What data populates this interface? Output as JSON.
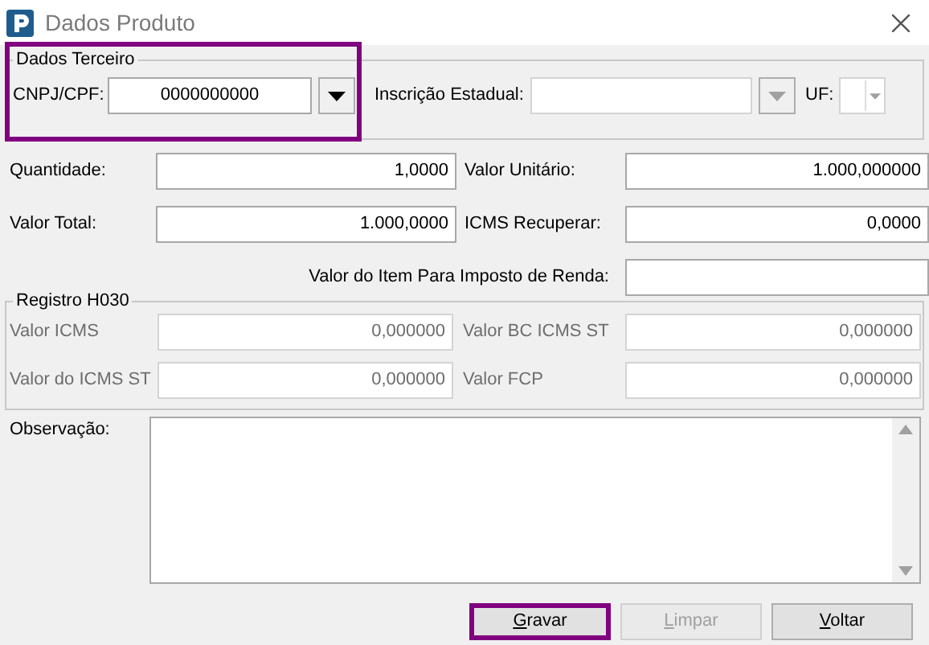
{
  "window": {
    "title": "Dados Produto"
  },
  "dados_terceiro": {
    "legend": "Dados Terceiro",
    "highlighted": true,
    "cnpj_cpf": {
      "label": "CNPJ/CPF:",
      "value": "0000000000",
      "disabled": false
    },
    "inscricao_estadual": {
      "label": "Inscrição Estadual:",
      "disabled": true
    },
    "uf": {
      "label": "UF:",
      "disabled": true
    }
  },
  "fields": [
    {
      "kind": "pair",
      "label": "Quantidade:",
      "value": "1,0000"
    },
    {
      "kind": "pair",
      "label": "Valor Unitário:",
      "value": "1.000,000000"
    },
    {
      "kind": "pair",
      "label": "Valor Total:",
      "value": "1.000,0000"
    },
    {
      "kind": "pair",
      "label": "ICMS Recuperar:",
      "value": "0,0000"
    },
    {
      "kind": "wide",
      "label": "Valor do Item Para Imposto de Renda:"
    }
  ],
  "registro_h030": {
    "legend": "Registro H030",
    "disabled": true,
    "fields": [
      {
        "label": "Valor ICMS",
        "value": "0,000000"
      },
      {
        "label": "Valor BC ICMS ST",
        "value": "0,000000"
      },
      {
        "label": "Valor do ICMS ST",
        "value": "0,000000"
      },
      {
        "label": "Valor FCP",
        "value": "0,000000"
      }
    ]
  },
  "observacao": {
    "label": "Observação:"
  },
  "buttons": [
    {
      "label": "Gravar",
      "underline_first": true,
      "disabled": false,
      "highlighted": true
    },
    {
      "label": "Limpar",
      "underline_first": true,
      "disabled": true,
      "highlighted": false
    },
    {
      "label": "Voltar",
      "underline_first": true,
      "disabled": false,
      "highlighted": false
    }
  ]
}
